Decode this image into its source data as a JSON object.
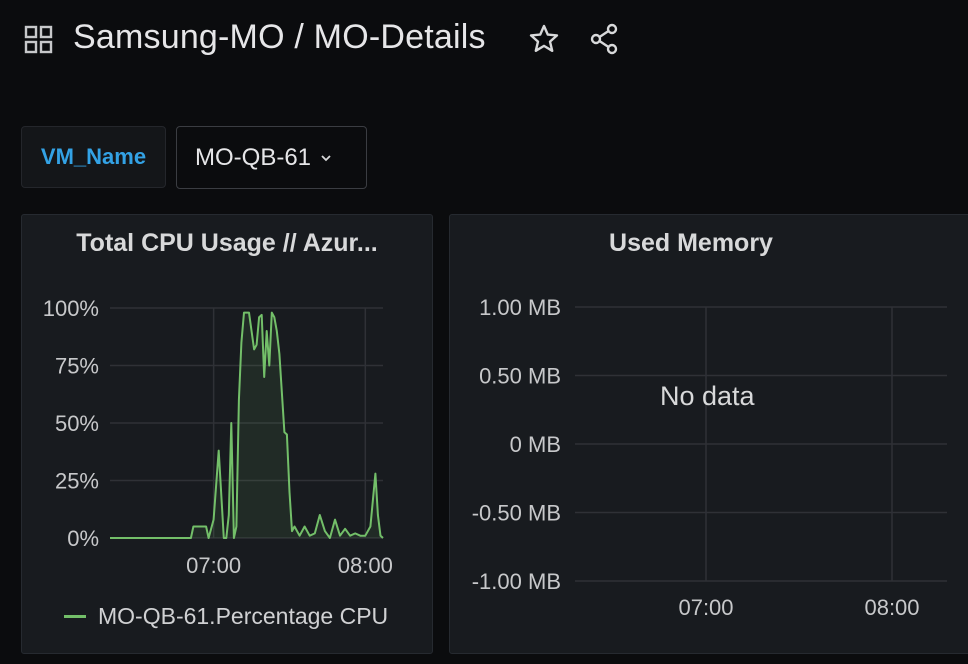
{
  "header": {
    "title": "Samsung-MO / MO-Details",
    "icons": [
      "grid-icon",
      "star-icon",
      "share-icon"
    ]
  },
  "variables": {
    "name_label": "VM_Name",
    "selected_value": "MO-QB-61"
  },
  "colors": {
    "series": "#73bf69",
    "variable_label": "#33a2e5",
    "background": "#0b0c0e",
    "panel": "#181b1f"
  },
  "panels": {
    "cpu": {
      "title": "Total CPU Usage // Azur...",
      "legend": "MO-QB-61.Percentage CPU"
    },
    "memory": {
      "title": "Used Memory",
      "no_data": "No data"
    }
  },
  "chart_data": [
    {
      "type": "area",
      "title": "Total CPU Usage // Azur...",
      "y_ticks": [
        "0%",
        "25%",
        "50%",
        "75%",
        "100%"
      ],
      "x_ticks": [
        "07:00",
        "08:00"
      ],
      "ylim": [
        0,
        100
      ],
      "xlim": [
        "06:19",
        "08:07"
      ],
      "x": [
        "06:19",
        "06:30",
        "06:51",
        "06:52",
        "06:57",
        "06:58",
        "07:00",
        "07:02",
        "07:04",
        "07:05",
        "07:06",
        "07:07",
        "07:08",
        "07:09",
        "07:10",
        "07:11",
        "07:12",
        "07:14",
        "07:16",
        "07:17",
        "07:18",
        "07:19",
        "07:20",
        "07:21",
        "07:22",
        "07:23",
        "07:24",
        "07:25",
        "07:26",
        "07:28",
        "07:29",
        "07:30",
        "07:31",
        "07:32",
        "07:34",
        "07:36",
        "07:38",
        "07:40",
        "07:42",
        "07:44",
        "07:46",
        "07:48",
        "07:50",
        "07:52",
        "07:54",
        "07:56",
        "07:58",
        "08:00",
        "08:02",
        "08:04",
        "08:05",
        "08:06",
        "08:07"
      ],
      "series": [
        {
          "name": "MO-QB-61.Percentage CPU",
          "values": [
            0,
            0,
            0,
            5,
            5,
            0,
            8,
            38,
            0,
            0,
            10,
            50,
            0,
            5,
            60,
            85,
            98,
            98,
            82,
            84,
            96,
            97,
            70,
            90,
            75,
            98,
            96,
            90,
            80,
            46,
            45,
            20,
            3,
            5,
            1,
            5,
            1,
            2,
            10,
            3,
            0,
            8,
            1,
            4,
            1,
            2,
            1,
            1,
            5,
            28,
            10,
            1,
            0
          ]
        }
      ],
      "legend": [
        "MO-QB-61.Percentage CPU"
      ],
      "grid": true
    },
    {
      "type": "line",
      "title": "Used Memory",
      "y_ticks": [
        "-1.00 MB",
        "-0.50 MB",
        "0 MB",
        "0.50 MB",
        "1.00 MB"
      ],
      "x_ticks": [
        "07:00",
        "08:00"
      ],
      "ylim": [
        -1,
        1
      ],
      "series": [],
      "grid": true
    }
  ]
}
